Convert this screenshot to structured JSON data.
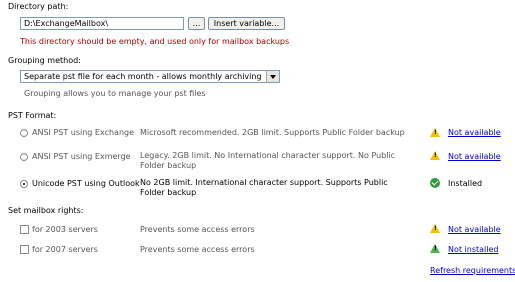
{
  "directory": {
    "label": "Directory path:",
    "value": "D:\\ExchangeMailbox\\",
    "browse_label": "...",
    "insert_variable_label": "Insert variable...",
    "warning": "This directory should be empty, and used only for mailbox backups"
  },
  "grouping": {
    "label": "Grouping method:",
    "selected": "Separate pst file for each month - allows monthly archiving",
    "hint": "Grouping allows you to manage your pst files"
  },
  "pst_format": {
    "label": "PST Format:",
    "options": [
      {
        "label": "ANSI PST using Exchange",
        "description": "Microsoft recommended. 2GB limit. Supports Public Folder backup",
        "status": "Not available",
        "status_icon": "warning-icon",
        "checked": false
      },
      {
        "label": "ANSI PST using Exmerge",
        "description": "Legacy. 2GB limit. No International character support. No Public Folder backup",
        "status": "Not available",
        "status_icon": "warning-icon",
        "checked": false
      },
      {
        "label": "Unicode PST using Outlook",
        "description": "No 2GB limit. International character support. Supports Public Folder backup",
        "status": "Installed",
        "status_icon": "ok-icon",
        "checked": true
      }
    ]
  },
  "mailbox_rights": {
    "label": "Set mailbox rights:",
    "options": [
      {
        "label": "for 2003 servers",
        "description": "Prevents some access errors",
        "status": "Not available",
        "status_icon": "warning-icon"
      },
      {
        "label": "for 2007 servers",
        "description": "Prevents some access errors",
        "status": "Not installed",
        "status_icon": "warning-green-icon"
      }
    ]
  },
  "refresh_label": "Refresh requirements"
}
